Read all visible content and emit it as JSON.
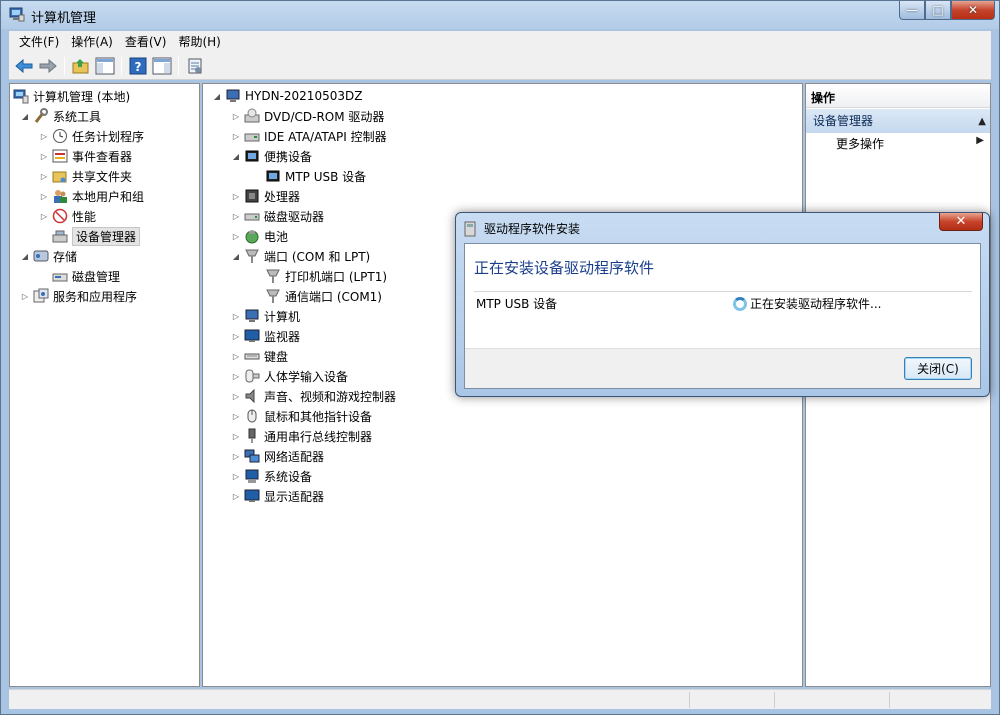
{
  "window": {
    "title": "计算机管理",
    "caption": {
      "minimize": "—",
      "maximize": "□",
      "close": "✕"
    }
  },
  "menu": [
    "文件(F)",
    "操作(A)",
    "查看(V)",
    "帮助(H)"
  ],
  "toolbar": [
    "back-icon",
    "forward-icon",
    "up-icon",
    "show-hide-tree-icon",
    "help-icon",
    "show-hide-action-pane-icon",
    "properties-icon"
  ],
  "left_tree": {
    "root": "计算机管理 (本地)",
    "system_tools": "系统工具",
    "items": [
      "任务计划程序",
      "事件查看器",
      "共享文件夹",
      "本地用户和组",
      "性能",
      "设备管理器"
    ],
    "storage": "存储",
    "disk_mgmt": "磁盘管理",
    "services": "服务和应用程序"
  },
  "device_tree": {
    "computer": "HYDN-20210503DZ",
    "dvd": "DVD/CD-ROM 驱动器",
    "ide": "IDE ATA/ATAPI 控制器",
    "portable": "便携设备",
    "mtp": "MTP USB 设备",
    "cpu": "处理器",
    "disk": "磁盘驱动器",
    "battery": "电池",
    "ports": "端口 (COM 和 LPT)",
    "lpt": "打印机端口 (LPT1)",
    "com": "通信端口 (COM1)",
    "computer_node": "计算机",
    "monitor": "监视器",
    "keyboard": "键盘",
    "hid": "人体学输入设备",
    "sound": "声音、视频和游戏控制器",
    "mouse": "鼠标和其他指针设备",
    "usb": "通用串行总线控制器",
    "network": "网络适配器",
    "system": "系统设备",
    "display": "显示适配器"
  },
  "actions": {
    "header": "操作",
    "section": "设备管理器",
    "more": "更多操作"
  },
  "dialog": {
    "title": "驱动程序软件安装",
    "heading": "正在安装设备驱动程序软件",
    "device": "MTP USB 设备",
    "status": "正在安装驱动程序软件...",
    "close_button": "关闭(C)",
    "close_glyph": "✕"
  },
  "colors": {
    "dialog_heading": "#1a3e8c",
    "selection": "#e4e4e4"
  }
}
